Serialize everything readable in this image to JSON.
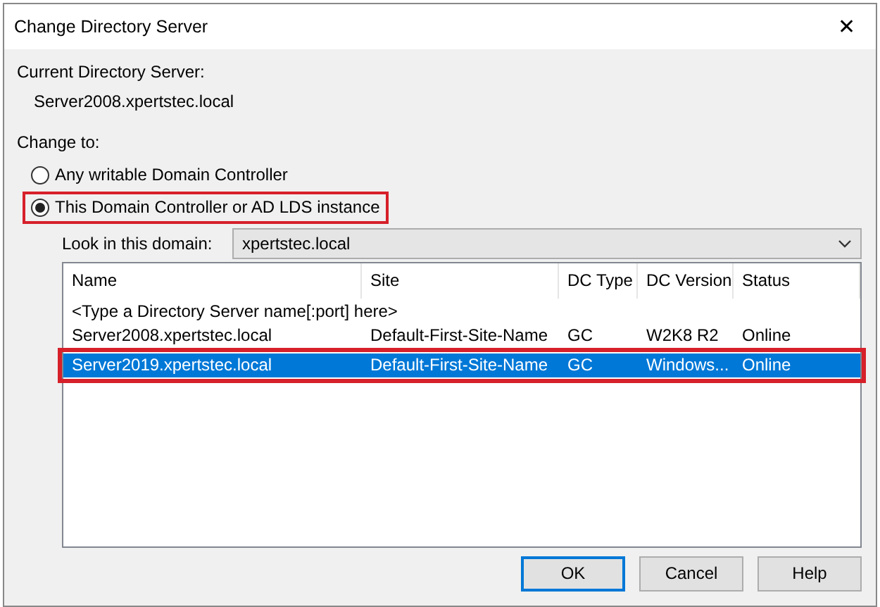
{
  "window": {
    "title": "Change Directory Server",
    "close": "✕"
  },
  "current_server": {
    "label": "Current Directory Server:",
    "value": "Server2008.xpertstec.local"
  },
  "change_to": {
    "label": "Change to:",
    "options": [
      {
        "label": "Any writable Domain Controller",
        "selected": false,
        "highlighted": false
      },
      {
        "label": "This Domain Controller or AD LDS instance",
        "selected": true,
        "highlighted": true
      }
    ]
  },
  "domain": {
    "label": "Look in this domain:",
    "value": "xpertstec.local"
  },
  "table": {
    "columns": [
      "Name",
      "Site",
      "DC Type",
      "DC Version",
      "Status"
    ],
    "prompt": "<Type a Directory Server name[:port] here>",
    "rows": [
      {
        "cells": [
          "Server2008.xpertstec.local",
          "Default-First-Site-Name",
          "GC",
          "W2K8 R2",
          "Online"
        ],
        "selected": false,
        "highlighted": false
      },
      {
        "cells": [
          "Server2019.xpertstec.local",
          "Default-First-Site-Name",
          "GC",
          "Windows...",
          "Online"
        ],
        "selected": true,
        "highlighted": true
      }
    ]
  },
  "buttons": [
    {
      "label": "OK",
      "default": true
    },
    {
      "label": "Cancel",
      "default": false
    },
    {
      "label": "Help",
      "default": false
    }
  ]
}
